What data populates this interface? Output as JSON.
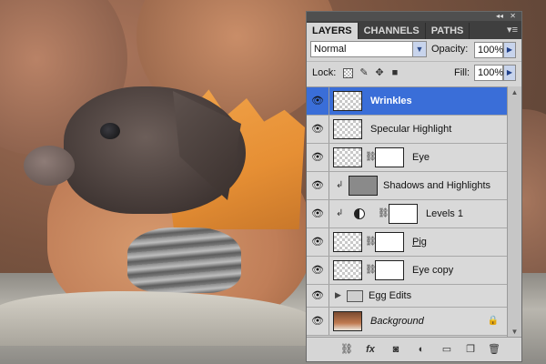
{
  "panel": {
    "collapse_glyph": "◂◂",
    "close_glyph": "✕",
    "menu_glyph": "▾≡",
    "tabs": [
      "LAYERS",
      "CHANNELS",
      "PATHS"
    ],
    "blend_mode": "Normal",
    "opacity_label": "Opacity:",
    "opacity_value": "100%",
    "lock_label": "Lock:",
    "fill_label": "Fill:",
    "fill_value": "100%"
  },
  "layers": [
    {
      "name": "Wrinkles",
      "selected": true
    },
    {
      "name": "Specular Highlight"
    },
    {
      "name": "Eye"
    },
    {
      "name": "Shadows and Highlights"
    },
    {
      "name": "Levels 1"
    },
    {
      "name": "Pig"
    },
    {
      "name": "Eye copy"
    },
    {
      "name": "Egg Edits"
    },
    {
      "name": "Background"
    }
  ],
  "bottom_icons": [
    "link-layers-icon",
    "fx-icon",
    "add-mask-icon",
    "new-adjustment-icon",
    "new-group-icon",
    "new-layer-icon",
    "trash-icon"
  ],
  "bottom_glyphs": {
    "fx": "fx"
  },
  "colors": {
    "selection": "#3a6ed8",
    "panel_bg": "#d6d6d6",
    "tab_bar": "#3f3f3f"
  }
}
